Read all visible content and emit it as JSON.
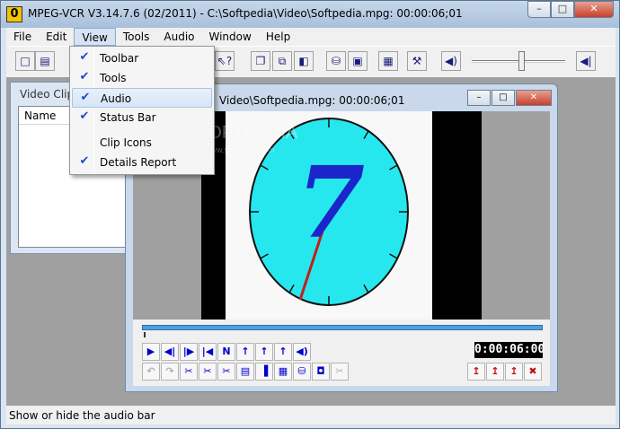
{
  "window": {
    "app_icon_glyph": "0",
    "title": "MPEG-VCR V3.14.7.6 (02/2011) - C:\\Softpedia\\Video\\Softpedia.mpg: 00:00:06;01",
    "min_glyph": "–",
    "max_glyph": "□",
    "close_glyph": "✕"
  },
  "menubar": {
    "items": [
      "File",
      "Edit",
      "View",
      "Tools",
      "Audio",
      "Window",
      "Help"
    ],
    "open_index": 2
  },
  "view_menu": {
    "items": [
      {
        "label": "Toolbar",
        "checked": true
      },
      {
        "label": "Tools",
        "checked": true
      },
      {
        "label": "Audio",
        "checked": true,
        "highlighted": true
      },
      {
        "label": "Status Bar",
        "checked": true
      },
      {
        "label": "Clip Icons",
        "checked": false
      },
      {
        "label": "Details Report",
        "checked": true
      }
    ],
    "check_glyph": "✔"
  },
  "toolbar": {
    "buttons": [
      {
        "icon": "new-file-icon",
        "glyph": "□"
      },
      {
        "icon": "open-jpeg-icon",
        "glyph": "▤"
      },
      {
        "icon": "help-pointer-icon",
        "glyph": "⇖?"
      },
      {
        "icon": "clip-copy-icon",
        "glyph": "❐"
      },
      {
        "icon": "clip-join-icon",
        "glyph": "⧉"
      },
      {
        "icon": "clip-split-icon",
        "glyph": "◧"
      },
      {
        "icon": "database-icon",
        "glyph": "⛁"
      },
      {
        "icon": "clip-export-icon",
        "glyph": "▣"
      },
      {
        "icon": "clip-details-icon",
        "glyph": "▦"
      },
      {
        "icon": "tools-icon",
        "glyph": "⚒"
      },
      {
        "icon": "speaker-icon",
        "glyph": "◀)"
      },
      {
        "icon": "volume-icon",
        "glyph": "◀|"
      }
    ],
    "volume_level": 0.5
  },
  "clip_window": {
    "title": "Video Clip",
    "column_name": "Name"
  },
  "video_window": {
    "title": "Video\\Softpedia.mpg: 00:00:06;01",
    "min_glyph": "–",
    "max_glyph": "□",
    "close_glyph": "✕",
    "clock_digit": "7",
    "watermark": "SOFTPEDIA",
    "watermark_url": "www.softpedia.com",
    "timecode": "0:00:06:00",
    "position": 0.0
  },
  "controls": {
    "row1": [
      {
        "icon": "play-icon",
        "glyph": "▶"
      },
      {
        "icon": "step-back-icon",
        "glyph": "◀|"
      },
      {
        "icon": "step-forward-icon",
        "glyph": "|▶"
      },
      {
        "icon": "skip-start-icon",
        "glyph": "|◀"
      },
      {
        "icon": "next-icon",
        "glyph": "N"
      },
      {
        "icon": "mark-in-icon",
        "glyph": "↑"
      },
      {
        "icon": "mark-up-icon",
        "glyph": "↑"
      },
      {
        "icon": "mark-out-icon",
        "glyph": "↑"
      },
      {
        "icon": "audio-icon",
        "glyph": "◀)"
      }
    ],
    "row2": [
      {
        "icon": "undo-icon",
        "glyph": "↶",
        "disabled": true
      },
      {
        "icon": "redo-icon",
        "glyph": "↷",
        "disabled": true
      },
      {
        "icon": "cut-icon",
        "glyph": "✂"
      },
      {
        "icon": "cut-alt-icon",
        "glyph": "✂"
      },
      {
        "icon": "cut-range-icon",
        "glyph": "✂"
      },
      {
        "icon": "clip-save-icon",
        "glyph": "▤"
      },
      {
        "icon": "marker-icon",
        "glyph": "▐"
      },
      {
        "icon": "clip-list-icon",
        "glyph": "▦"
      },
      {
        "icon": "db-icon",
        "glyph": "⛁"
      },
      {
        "icon": "camera-icon",
        "glyph": "◘"
      },
      {
        "icon": "trim-icon",
        "glyph": "✂",
        "disabled": true
      }
    ],
    "row2_right": [
      {
        "icon": "goto-in-icon",
        "glyph": "↥"
      },
      {
        "icon": "goto-mark-icon",
        "glyph": "↥"
      },
      {
        "icon": "goto-out-icon",
        "glyph": "↥"
      },
      {
        "icon": "delete-mark-icon",
        "glyph": "✖"
      }
    ]
  },
  "statusbar": {
    "text": "Show or hide the audio bar"
  },
  "colors": {
    "clock_face": "#27e7ee",
    "clock_digit": "#1a26c9",
    "clock_hand": "#c0201a",
    "video_bg": "#f8f8f8",
    "control_blue": "#0000cc",
    "control_red": "#c01010"
  }
}
